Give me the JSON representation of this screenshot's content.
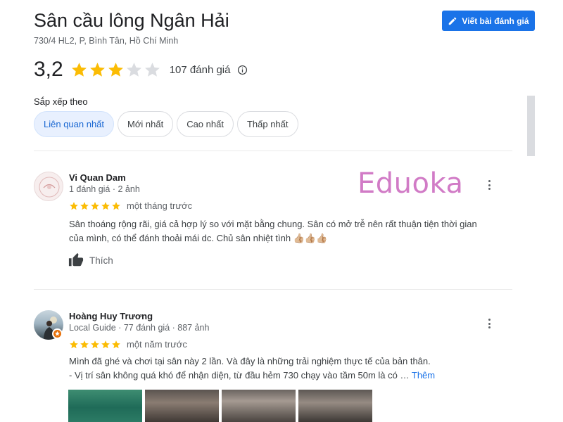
{
  "place": {
    "title": "Sân cầu lông Ngân Hải",
    "address": "730/4 HL2, P, Bình Tân, Hồ Chí Minh"
  },
  "actions": {
    "write_review_label": "Viết bài đánh giá"
  },
  "summary": {
    "rating_text": "3,2",
    "rating_value": 3.2,
    "stars_filled": 3,
    "stars_total": 5,
    "review_count_label": "107 đánh giá"
  },
  "sort": {
    "label": "Sắp xếp theo",
    "options": [
      "Liên quan nhất",
      "Mới nhất",
      "Cao nhất",
      "Thấp nhất"
    ],
    "selected": "Liên quan nhất"
  },
  "watermark": "Eduoka",
  "reviews": [
    {
      "name": "Vi Quan Dam",
      "meta": "1 đánh giá · 2 ảnh",
      "stars": 5,
      "time": "một tháng trước",
      "text_line1": "Sân thoáng rộng rãi, giá cả hợp lý so với mặt bằng chung. Sân có mở trễ nên rất thuận tiện thời gian",
      "text_line2": "của mình, có thể đánh thoải mái dc. Chủ sân nhiệt tình 👍🏼👍🏼👍🏼",
      "like_label": "Thích"
    },
    {
      "name": "Hoàng Huy Trương",
      "meta": "Local Guide · 77 đánh giá · 887 ảnh",
      "stars": 5,
      "time": "một năm trước",
      "text_line1": "Mình đã ghé và chơi tại sân này 2 lần. Và đây là những trải nghiệm thực tế của bản thân.",
      "text_line2": "- Vị trí sân không quá khó để nhận diện, từ đầu hẻm 730 chạy vào tầm 50m là có … ",
      "more_label": "Thêm"
    }
  ],
  "colors": {
    "accent": "#1a73e8",
    "star": "#fbbc04",
    "star_empty": "#dadce0",
    "watermark": "#d17bc6"
  }
}
